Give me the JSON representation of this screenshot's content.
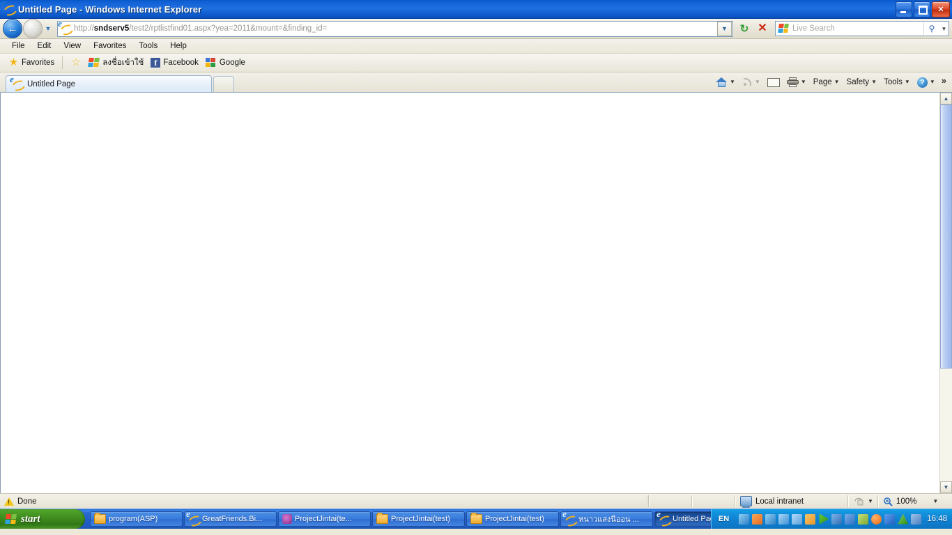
{
  "window": {
    "title": "Untitled Page - Windows Internet Explorer",
    "ie_icon": "ie-logo-icon",
    "minimize_label": "Minimize",
    "maximize_label": "Restore",
    "close_label": "Close"
  },
  "navigation": {
    "back_label": "Back",
    "forward_label": "Forward",
    "recent_pages_label": "Recent Pages",
    "back_glyph": "←",
    "forward_glyph": "→",
    "dropdown_glyph": "▼",
    "refresh_glyph": "↻",
    "stop_glyph": "✕"
  },
  "address": {
    "url_scheme": "http://",
    "url_host": "sndserv5",
    "url_path": "/test2/rptlistfind01.aspx?yea=2011&mount=&finding_id=",
    "full_url": "http://sndserv5/test2/rptlistfind01.aspx?yea=2011&mount=&finding_id=",
    "dropdown_glyph": "▼"
  },
  "search": {
    "placeholder": "Live Search",
    "go_glyph": "⚲",
    "dropdown_glyph": "▼",
    "provider_icon": "windows-flag-icon"
  },
  "menubar": {
    "items": [
      {
        "label": "File"
      },
      {
        "label": "Edit"
      },
      {
        "label": "View"
      },
      {
        "label": "Favorites"
      },
      {
        "label": "Tools"
      },
      {
        "label": "Help"
      }
    ]
  },
  "favorites_bar": {
    "favorites_label": "Favorites",
    "add_label": "Add to Favorites Bar",
    "links": [
      {
        "label": "ลงชื่อเข้าใช้",
        "icon": "windows-flag-icon"
      },
      {
        "label": "Facebook",
        "icon": "facebook-icon",
        "glyph": "f"
      },
      {
        "label": "Google",
        "icon": "google-icon"
      }
    ]
  },
  "tabs": {
    "items": [
      {
        "label": "Untitled Page",
        "icon": "ie-logo-icon",
        "active": true
      }
    ],
    "new_tab_label": "New Tab"
  },
  "command_bar": {
    "home_label": "Home",
    "feeds_label": "Feeds",
    "mail_label": "Read Mail",
    "print_label": "Print",
    "items": [
      {
        "label": "Page"
      },
      {
        "label": "Safety"
      },
      {
        "label": "Tools"
      }
    ],
    "help_label": "Help",
    "help_glyph": "?",
    "overflow_glyph": "»",
    "caret_glyph": "▼"
  },
  "content": {
    "body_text": ""
  },
  "scrollbar": {
    "up_glyph": "▲",
    "down_glyph": "▼",
    "thumb_percent": 70
  },
  "statusbar": {
    "status_text": "Done",
    "status_icon": "warning-triangle-icon",
    "zone_text": "Local intranet",
    "zone_icon": "intranet-zone-icon",
    "protected_icon": "protected-mode-icon",
    "protected_caret": "▼",
    "zoom_text": "100%",
    "zoom_icon": "zoom-magnifier-icon",
    "zoom_caret": "▼"
  },
  "taskbar": {
    "start_label": "start",
    "items": [
      {
        "label": "program(ASP)",
        "icon": "folder-icon",
        "active": false
      },
      {
        "label": "GreatFriends.Bi...",
        "icon": "ie-logo-icon",
        "active": false
      },
      {
        "label": "ProjectJintai(te...",
        "icon": "visual-studio-icon",
        "active": false
      },
      {
        "label": "ProjectJintai(test)",
        "icon": "folder-icon",
        "active": false
      },
      {
        "label": "ProjectJintai(test)",
        "icon": "folder-icon",
        "active": false
      },
      {
        "label": "หนาวแสงนีออน ...",
        "icon": "ie-logo-icon",
        "active": false
      },
      {
        "label": "Untitled Page - ...",
        "icon": "ie-logo-icon",
        "active": true
      }
    ],
    "tray": {
      "language": "EN",
      "clock": "16:48",
      "icons": [
        {
          "name": "network-icon",
          "color": "#2f7fc4"
        },
        {
          "name": "puzzle-icon",
          "color": "#e86a1f"
        },
        {
          "name": "network-activity-icon",
          "color": "#2f7fc4"
        },
        {
          "name": "speaker-network-icon",
          "color": "#3f8fd4"
        },
        {
          "name": "display-icon",
          "color": "#5aa0dc"
        },
        {
          "name": "printer-icon",
          "color": "#e8962a"
        },
        {
          "name": "media-play-icon",
          "color": "#3aa017"
        },
        {
          "name": "network-disconnected-icon",
          "color": "#2f6fb4"
        },
        {
          "name": "volume-icon",
          "color": "#2d6fc0"
        },
        {
          "name": "antivirus-icon",
          "color": "#7aa832"
        },
        {
          "name": "updates-icon",
          "color": "#e8640f"
        },
        {
          "name": "bluetooth-icon",
          "color": "#1f5fc0"
        },
        {
          "name": "warning-icon",
          "color": "#3ba33b"
        },
        {
          "name": "tools-icon",
          "color": "#4d7fc0"
        }
      ]
    }
  },
  "colors": {
    "titlebar_blue": "#1565d8",
    "taskbar_blue": "#225fc8",
    "start_green": "#3d8a1e",
    "chrome_beige": "#ece9d8",
    "page_white": "#ffffff"
  }
}
